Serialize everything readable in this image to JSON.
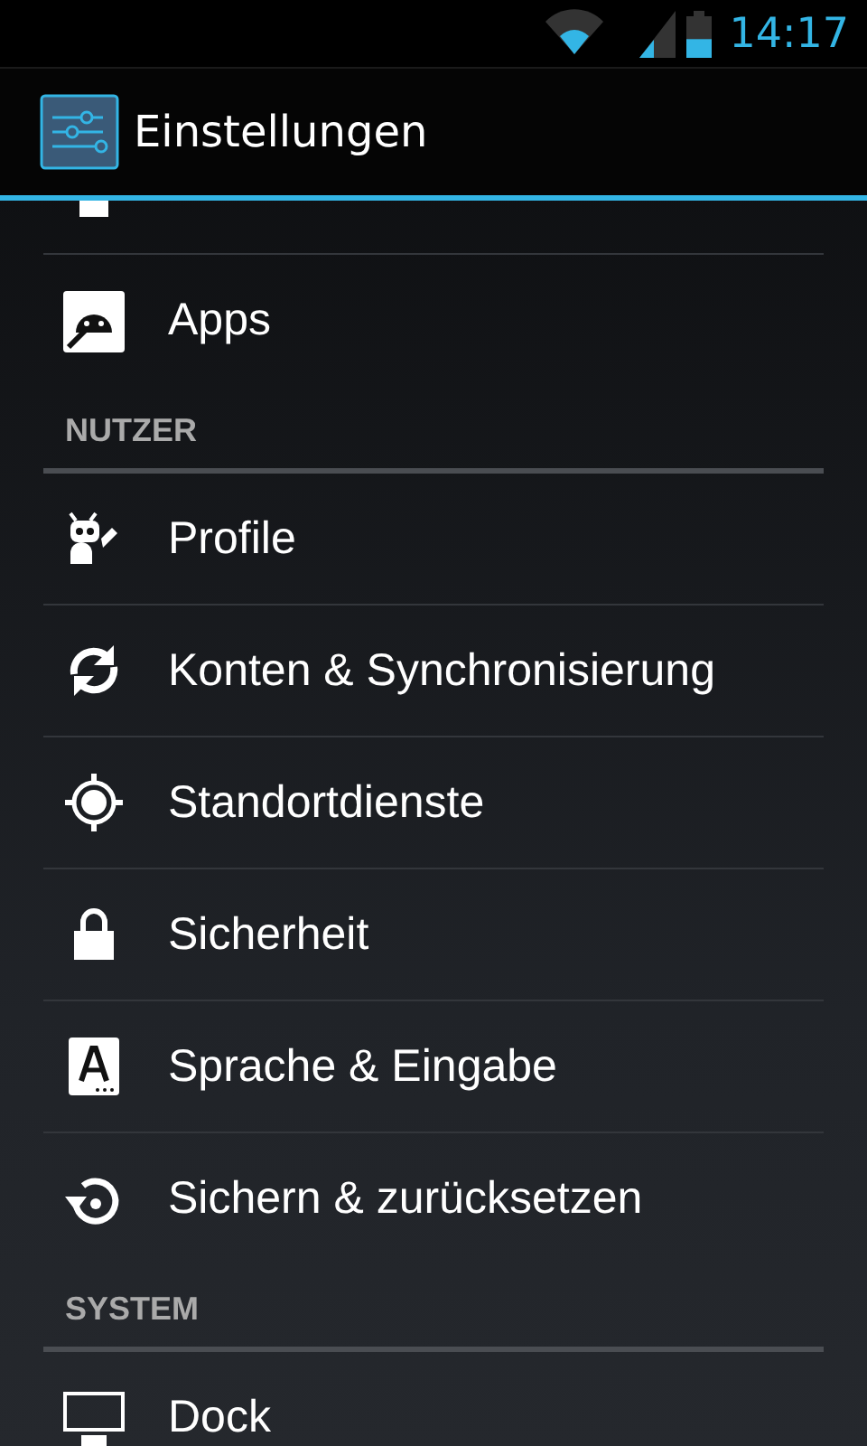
{
  "status_bar": {
    "time": "14:17"
  },
  "action_bar": {
    "title": "Einstellungen"
  },
  "sections": [
    {
      "items": [
        {
          "label": "Apps"
        }
      ]
    },
    {
      "header": "NUTZER",
      "items": [
        {
          "label": "Profile"
        },
        {
          "label": "Konten & Synchronisierung"
        },
        {
          "label": "Standortdienste"
        },
        {
          "label": "Sicherheit"
        },
        {
          "label": "Sprache & Eingabe"
        },
        {
          "label": "Sichern & zurücksetzen"
        }
      ]
    },
    {
      "header": "SYSTEM",
      "items": [
        {
          "label": "Dock"
        }
      ]
    }
  ]
}
